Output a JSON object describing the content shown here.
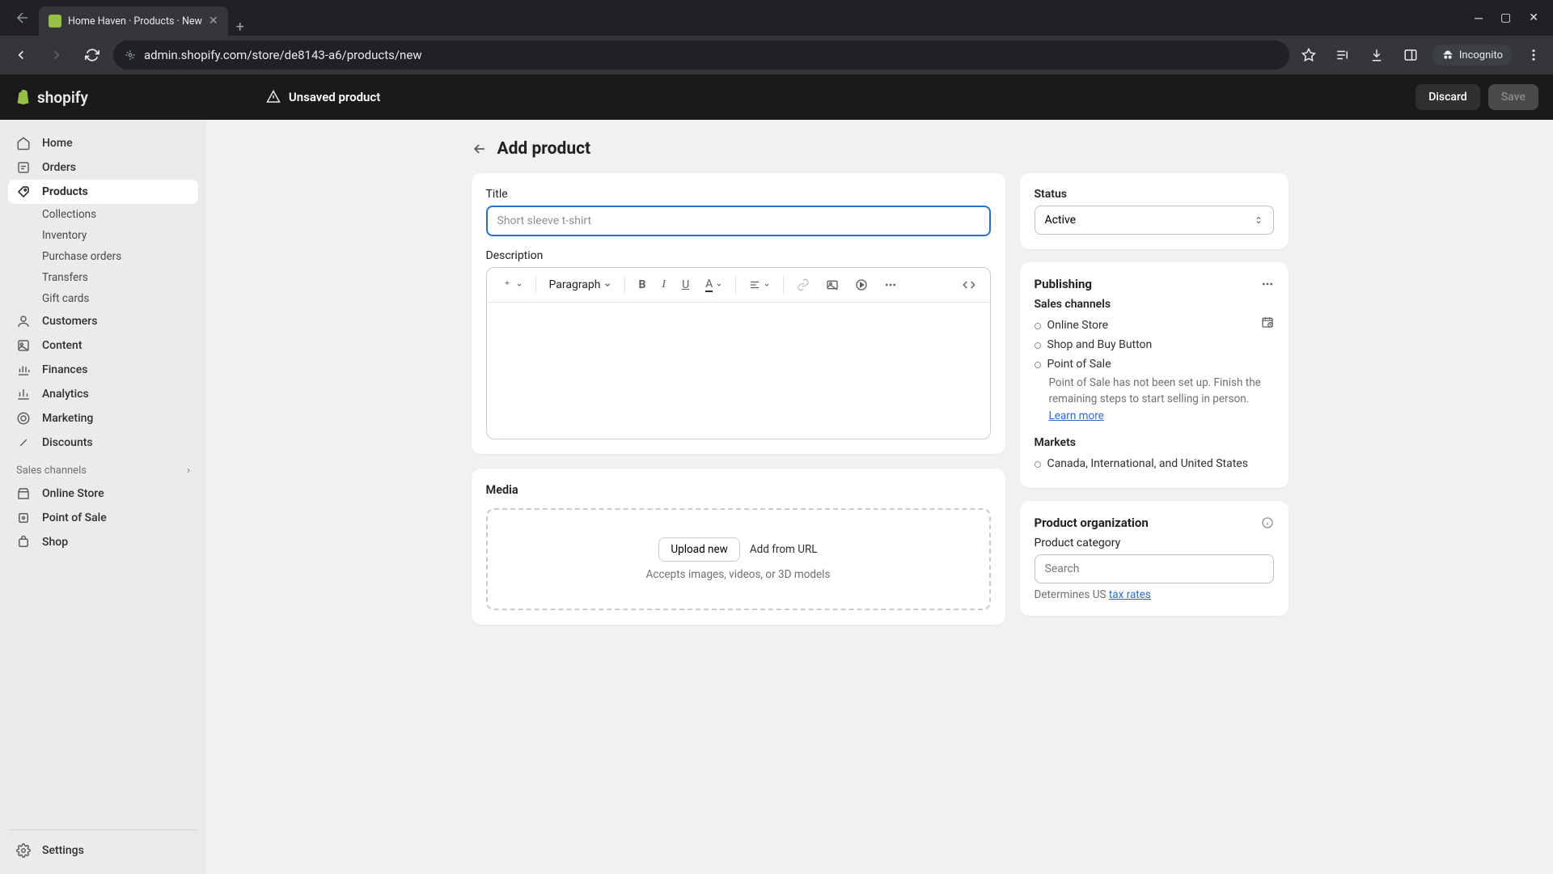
{
  "browser": {
    "tab_title": "Home Haven · Products · New",
    "url": "admin.shopify.com/store/de8143-a6/products/new",
    "incognito_label": "Incognito"
  },
  "app_bar": {
    "brand": "shopify",
    "unsaved_msg": "Unsaved product",
    "discard": "Discard",
    "save": "Save"
  },
  "sidebar": {
    "home": "Home",
    "orders": "Orders",
    "products": "Products",
    "collections": "Collections",
    "inventory": "Inventory",
    "purchase_orders": "Purchase orders",
    "transfers": "Transfers",
    "gift_cards": "Gift cards",
    "customers": "Customers",
    "content": "Content",
    "finances": "Finances",
    "analytics": "Analytics",
    "marketing": "Marketing",
    "discounts": "Discounts",
    "sales_channels_label": "Sales channels",
    "online_store": "Online Store",
    "point_of_sale": "Point of Sale",
    "shop": "Shop",
    "settings": "Settings"
  },
  "page": {
    "title": "Add product",
    "form": {
      "title_label": "Title",
      "title_placeholder": "Short sleeve t-shirt",
      "description_label": "Description",
      "paragraph_label": "Paragraph"
    },
    "media": {
      "heading": "Media",
      "upload": "Upload new",
      "add_url": "Add from URL",
      "hint": "Accepts images, videos, or 3D models"
    }
  },
  "status": {
    "label": "Status",
    "value": "Active"
  },
  "publishing": {
    "heading": "Publishing",
    "sales_channels": "Sales channels",
    "online_store": "Online Store",
    "shop_buy": "Shop and Buy Button",
    "pos": "Point of Sale",
    "pos_note": "Point of Sale has not been set up. Finish the remaining steps to start selling in person.",
    "learn_more": "Learn more",
    "markets": "Markets",
    "markets_value": "Canada, International, and United States"
  },
  "org": {
    "heading": "Product organization",
    "category_label": "Product category",
    "search_placeholder": "Search",
    "helper_prefix": "Determines US ",
    "helper_link": "tax rates"
  }
}
